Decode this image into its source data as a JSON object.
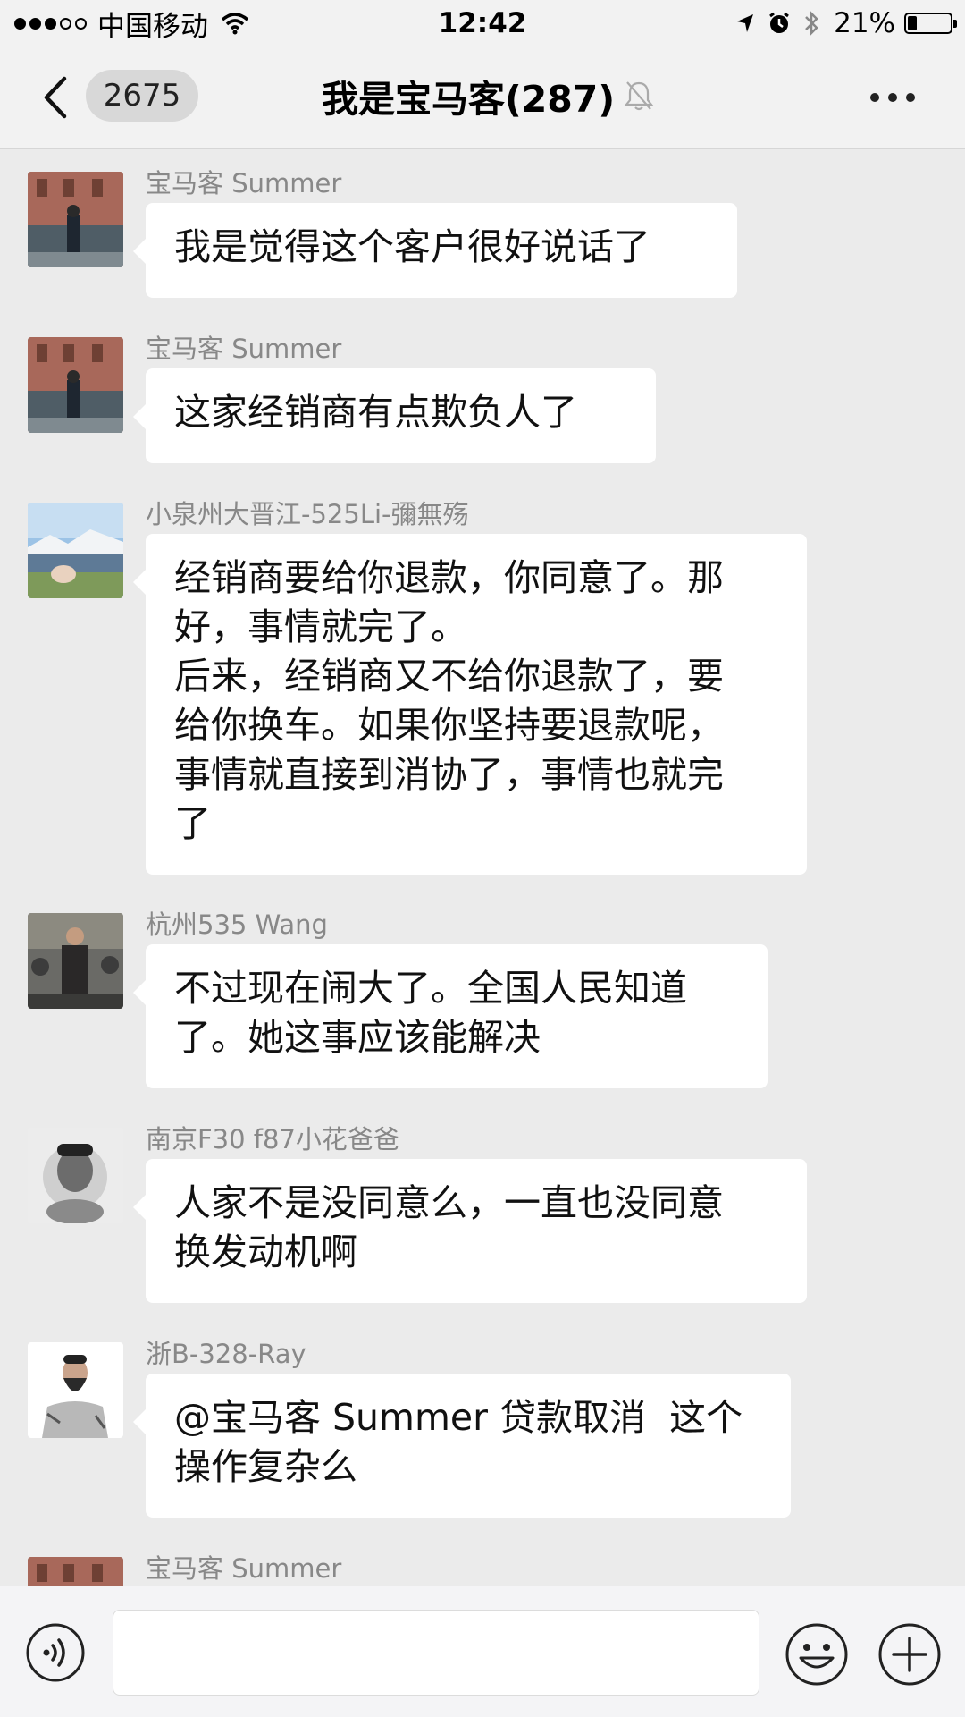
{
  "status_bar": {
    "carrier": "中国移动",
    "time": "12:42",
    "battery_percent_text": "21%",
    "battery_level": 0.21,
    "signal_bars_filled": 3,
    "signal_bars_total": 5
  },
  "nav": {
    "back_icon": "chevron-left-icon",
    "unread_count": "2675",
    "title": "我是宝马客(287)",
    "mute_icon": "bell-muted-icon",
    "more_icon": "more-dots-icon"
  },
  "messages": [
    {
      "sender": "宝马客 Summer",
      "text": "我是觉得这个客户很好说话了",
      "avatar": "street-photo"
    },
    {
      "sender": "宝马客 Summer",
      "text": "这家经销商有点欺负人了",
      "avatar": "street-photo"
    },
    {
      "sender": "小泉州大晋江-525Li-彌無殇",
      "text": "经销商要给你退款，你同意了。那\n好，事情就完了。\n后来，经销商又不给你退款了，要\n给你换车。如果你坚持要退款呢，\n事情就直接到消协了，事情也就完\n了",
      "avatar": "landscape-photo"
    },
    {
      "sender": "杭州535 Wang",
      "text": "不过现在闹大了。全国人民知道\n了。她这事应该能解决",
      "avatar": "man-crowd-photo"
    },
    {
      "sender": "南京F30 f87小花爸爸",
      "text": "人家不是没同意么，一直也没同意\n换发动机啊",
      "avatar": "bw-portrait"
    },
    {
      "sender": "浙B-328-Ray",
      "text": "@宝马客 Summer 贷款取消  这个\n操作复杂么",
      "avatar": "bearded-man"
    },
    {
      "sender": "宝马客 Summer",
      "text": "",
      "avatar": "street-photo"
    }
  ],
  "input_bar": {
    "voice_icon": "voice-icon",
    "emoji_icon": "emoji-icon",
    "plus_icon": "plus-icon",
    "input_value": ""
  },
  "colors": {
    "chat_background": "#ebebeb",
    "bubble": "#ffffff",
    "sender_name": "#888888"
  }
}
